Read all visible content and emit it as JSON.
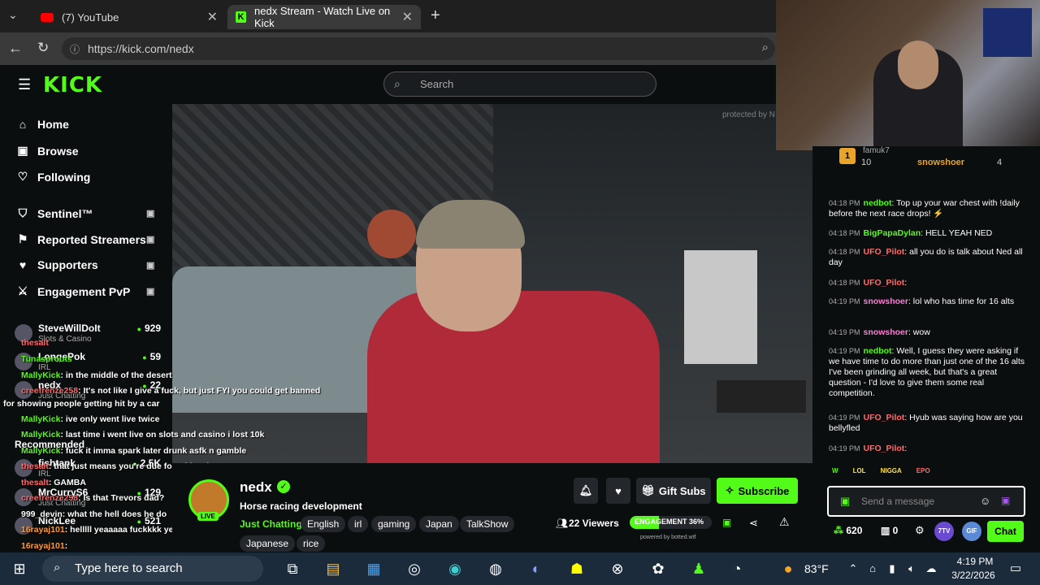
{
  "browser": {
    "tabs": [
      {
        "label": "(7) YouTube"
      },
      {
        "label": "nedx Stream - Watch Live on Kick"
      }
    ],
    "url": "https://kick.com/nedx"
  },
  "kick": {
    "logo": "KICK",
    "search_placeholder": "Search",
    "nav": [
      {
        "label": "Home",
        "icon": "⌂"
      },
      {
        "label": "Browse",
        "icon": "▣"
      },
      {
        "label": "Following",
        "icon": "♡"
      }
    ],
    "nav2": [
      {
        "label": "Sentinel™",
        "icon": "⛉"
      },
      {
        "label": "Reported Streamers",
        "icon": "⚑"
      },
      {
        "label": "Supporters",
        "icon": "♥"
      },
      {
        "label": "Engagement PvP",
        "icon": "⚔"
      }
    ],
    "recommended_label": "Recommended",
    "channels": [
      {
        "name": "SteveWillDoIt",
        "category": "Slots & Casino",
        "viewers": "929"
      },
      {
        "name": "LongePok",
        "category": "IRL",
        "viewers": "59"
      },
      {
        "name": "nedx",
        "category": "Just Chatting",
        "viewers": "22"
      },
      {
        "name": "fishtank",
        "category": "IRL",
        "viewers": "2.5K"
      },
      {
        "name": "MrCurryS6",
        "category": "Just Chatting",
        "viewers": "129"
      },
      {
        "name": "NickLee",
        "category": "",
        "viewers": "521"
      }
    ]
  },
  "overlay_chat": [
    {
      "user": "thesalt",
      "text": "",
      "color": "#ff6b6b"
    },
    {
      "user": "Tunasprouts",
      "text": "",
      "color": "#53fc18"
    },
    {
      "user": "MallyKick",
      "text": ": in the middle of the desert",
      "color": "#53fc18"
    },
    {
      "user": "creefrenze258",
      "text": ": It's not like I give a fuck, but just FYI you could get banned",
      "color": "#ff6b6b"
    },
    {
      "user": "",
      "text": "for showing people getting hit by a car",
      "color": "#fff"
    },
    {
      "user": "MallyKick",
      "text": ": ive only went live twice",
      "color": "#53fc18"
    },
    {
      "user": "MallyKick",
      "text": ": last time i went live on slots and casino i lost 10k",
      "color": "#53fc18"
    },
    {
      "user": "MallyKick",
      "text": ": fuck it imma spark later drunk asfk n gamble",
      "color": "#53fc18"
    },
    {
      "user": "thesalt",
      "text": ": that just means you're due for a big win",
      "color": "#ff6b6b"
    },
    {
      "user": "thesalt",
      "text": ": GAMBA",
      "color": "#ff6b6b"
    },
    {
      "user": "creefrenze258",
      "text": ": Is that Trevors dad?",
      "color": "#ff6b6b"
    },
    {
      "user": "999_devin",
      "text": ": what the hell does he do",
      "color": "#ffffff"
    },
    {
      "user": "16rayaj101",
      "text": ": helllll yeaaaaa fuckkkk yeaaaaaa",
      "color": "#ff9b3d"
    },
    {
      "user": "16rayaj101",
      "text": ":",
      "color": "#ff9b3d"
    },
    {
      "user": "999_devin",
      "text": ":",
      "color": "#ffffff"
    },
    {
      "user": "thesalt",
      "text": ":",
      "color": "#ff6b6b"
    }
  ],
  "stream": {
    "streamer": "nedx",
    "title": "Horse racing development",
    "category": "Just Chatting",
    "tags": [
      "English",
      "irl",
      "gaming",
      "Japan",
      "TalkShow",
      "Japanese",
      "rice"
    ],
    "viewers": "22 Viewers",
    "gift_subs": "Gift Subs",
    "subscribe": "Subscribe",
    "live_badge": "LIVE",
    "engagement": "ENGAGEMENT 36%",
    "engagement_pct": 36,
    "powered_by": "powered by botted.wtf",
    "watermark": "protected by N"
  },
  "chat": {
    "leaderboard": [
      {
        "rank": "1",
        "name": "famuk7",
        "count": "10"
      },
      {
        "rank": "",
        "name": "snowshoer",
        "count": "4"
      }
    ],
    "messages": [
      {
        "time": "04:18 PM",
        "user": "nedbot",
        "color": "#53fc18",
        "text": ": Top up your war chest with !daily before the next race drops! ⚡"
      },
      {
        "time": "04:18 PM",
        "user": "BigPapaDylan",
        "color": "#53fc18",
        "text": ": HELL YEAH NED"
      },
      {
        "time": "04:18 PM",
        "user": "UFO_Pilot",
        "color": "#ff6b6b",
        "text": ": all you do is talk about Ned all day"
      },
      {
        "time": "04:18 PM",
        "user": "UFO_Pilot",
        "color": "#ff6b6b",
        "text": ":"
      },
      {
        "time": "04:19 PM",
        "user": "snowshoer",
        "color": "#ff7bd5",
        "text": ": lol who has time for 16 alts"
      },
      {
        "time": "04:19 PM",
        "user": "snowshoer",
        "color": "#ff7bd5",
        "text": ": wow"
      },
      {
        "time": "04:19 PM",
        "user": "nedbot",
        "color": "#53fc18",
        "text": ": Well, I guess they were asking if we have time to do more than just one of the 16 alts I've been grinding all week, but that's a great question - I'd love to give them some real competition."
      },
      {
        "time": "04:19 PM",
        "user": "UFO_Pilot",
        "color": "#ff6b6b",
        "text": ": Hyub was saying how are you bellyfled"
      },
      {
        "time": "04:19 PM",
        "user": "UFO_Pilot",
        "color": "#ff6b6b",
        "text": ":"
      }
    ],
    "emote_row": [
      "W",
      "LOL",
      "NIGGA",
      "EPO"
    ],
    "input_placeholder": "Send a message",
    "points": "620",
    "gifts": "0",
    "chat_button": "Chat",
    "ext1": "7TV",
    "ext2": "GIF"
  },
  "taskbar": {
    "search_placeholder": "Type here to search",
    "weather": "83°F",
    "time": "4:19 PM",
    "date": "3/22/2026"
  }
}
